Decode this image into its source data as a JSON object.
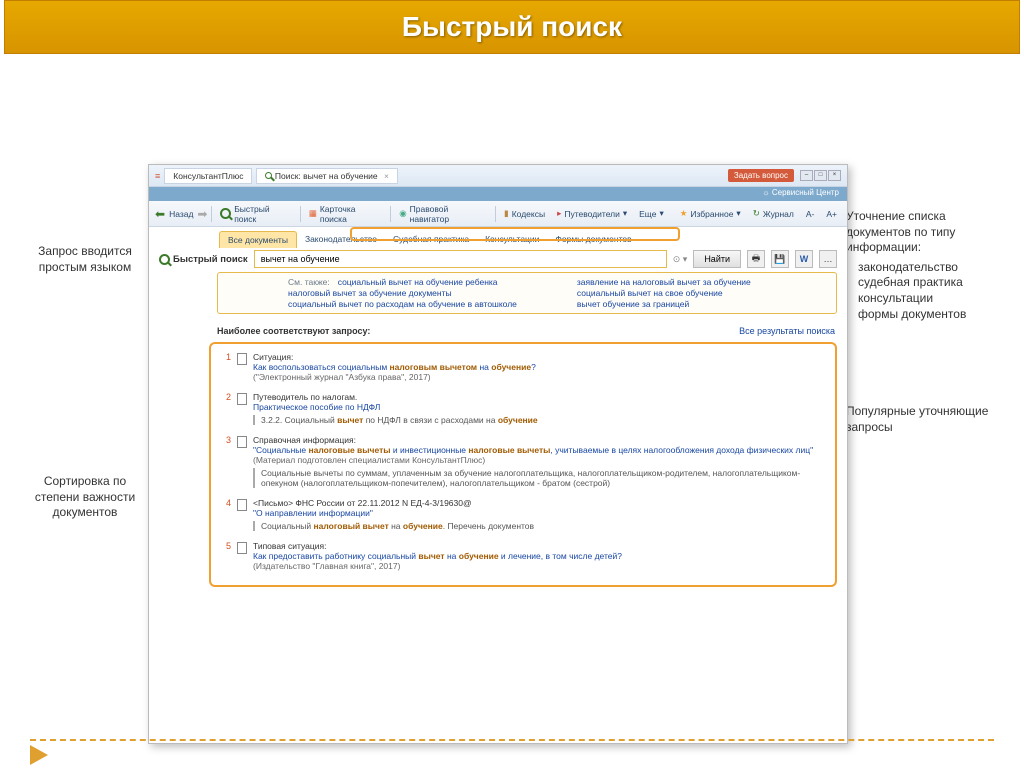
{
  "slide_title": "Быстрый поиск",
  "annotations": {
    "left1": "Запрос вводится простым языком",
    "left2": "Сортировка по степени важности документов",
    "right1_head": "Уточнение списка документов по типу информации:",
    "right1_items": [
      "законодательство",
      "судебная практика",
      "консультации",
      "формы документов"
    ],
    "right2": "Популярные уточняющие запросы"
  },
  "titlebar": {
    "tab1": "КонсультантПлюс",
    "tab2": "Поиск: вычет на обучение",
    "ask": "Задать вопрос"
  },
  "service_bar": "Сервисный Центр",
  "toolbar": {
    "back": "Назад",
    "quick": "Быстрый поиск",
    "card": "Карточка поиска",
    "navigator": "Правовой навигатор",
    "codex": "Кодексы",
    "guide": "Путеводители",
    "more": "Еще",
    "favorites": "Избранное",
    "journal": "Журнал",
    "font_minus": "A-",
    "font_plus": "A+"
  },
  "filters": {
    "all": "Все документы",
    "law": "Законодательство",
    "court": "Судебная практика",
    "consult": "Консультации",
    "forms": "Формы документов"
  },
  "search": {
    "label": "Быстрый поиск",
    "value": "вычет на обучение",
    "find": "Найти"
  },
  "see_also": {
    "label": "См. также:",
    "col1": [
      "социальный вычет на обучение ребенка",
      "налоговый вычет за обучение документы",
      "социальный вычет по расходам на обучение в автошколе"
    ],
    "col2": [
      "заявление на налоговый вычет за обучение",
      "социальный вычет на свое обучение",
      "вычет обучение за границей"
    ]
  },
  "results_header": {
    "title": "Наиболее соответствуют запросу:",
    "all": "Все результаты поиска"
  },
  "results": [
    {
      "num": "1",
      "type": "Ситуация:",
      "link_pre": "Как воспользоваться социальным ",
      "link_hl1": "налоговым вычетом",
      "link_mid": " на ",
      "link_hl2": "обучение",
      "link_post": "?",
      "meta": "(\"Электронный журнал \"Азбука права\", 2017)"
    },
    {
      "num": "2",
      "type": "Путеводитель по налогам.",
      "link": "Практическое пособие по НДФЛ",
      "excerpt_pre": "3.2.2. Социальный ",
      "excerpt_hl1": "вычет",
      "excerpt_mid": " по НДФЛ в связи с расходами на ",
      "excerpt_hl2": "обучение"
    },
    {
      "num": "3",
      "type": "Справочная информация:",
      "link_pre": "\"Социальные ",
      "link_hl1": "налоговые вычеты",
      "link_mid": " и инвестиционные ",
      "link_hl2": "налоговые вычеты",
      "link_post": ", учитываемые в целях налогообложения дохода физических лиц\"",
      "meta": "(Материал подготовлен специалистами КонсультантПлюс)",
      "excerpt": "Социальные вычеты по суммам, уплаченным за обучение налогоплательщика, налогоплательщиком-родителем, налогоплательщиком-опекуном (налогоплательщиком-попечителем), налогоплательщиком - братом (сестрой)"
    },
    {
      "num": "4",
      "type": "<Письмо> ФНС России от 22.11.2012 N ЕД-4-3/19630@",
      "link": "\"О направлении информации\"",
      "excerpt_pre": "Социальный ",
      "excerpt_hl1": "налоговый вычет",
      "excerpt_mid": " на ",
      "excerpt_hl2": "обучение",
      "excerpt_post": ". Перечень документов"
    },
    {
      "num": "5",
      "type": "Типовая ситуация:",
      "link_pre": "Как предоставить работнику социальный ",
      "link_hl1": "вычет",
      "link_mid": " на ",
      "link_hl2": "обучение",
      "link_post": " и лечение, в том числе детей?",
      "meta": "(Издательство \"Главная книга\", 2017)"
    }
  ]
}
